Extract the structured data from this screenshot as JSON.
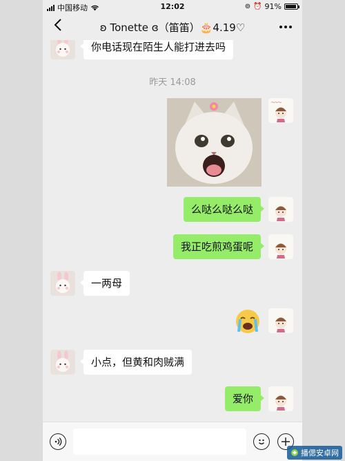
{
  "status_bar": {
    "carrier": "中国移动",
    "time": "12:02",
    "battery": "91%",
    "battery_level": 0.91
  },
  "header": {
    "back_icon": "chevron-left-icon",
    "title": "ʚ Tonette ɞ（笛笛）🎂4.19♡",
    "more_icon": "more-dots-icon"
  },
  "messages": [
    {
      "side": "in",
      "type": "text",
      "text": "你电话现在陌生人能打进去吗"
    },
    {
      "type": "timestamp",
      "text": "昨天 14:08"
    },
    {
      "side": "out",
      "type": "image",
      "image": "cat-photo"
    },
    {
      "side": "out",
      "type": "text",
      "text": "么哒么哒么哒"
    },
    {
      "side": "out",
      "type": "text",
      "text": "我正吃煎鸡蛋呢"
    },
    {
      "side": "in",
      "type": "text",
      "text": "一两母"
    },
    {
      "side": "out",
      "type": "sticker",
      "image": "crying-emoji"
    },
    {
      "side": "in",
      "type": "text",
      "text": "小点，但黄和肉贼满"
    },
    {
      "side": "out",
      "type": "text",
      "text": "爱你"
    }
  ],
  "input_bar": {
    "voice_icon": "voice-icon",
    "emoji_icon": "emoji-icon",
    "plus_icon": "plus-icon",
    "input_value": ""
  },
  "watermark": "播偲安卓网",
  "colors": {
    "outgoing_bubble": "#95ec69",
    "incoming_bubble": "#ffffff",
    "chat_background": "#ededed"
  }
}
